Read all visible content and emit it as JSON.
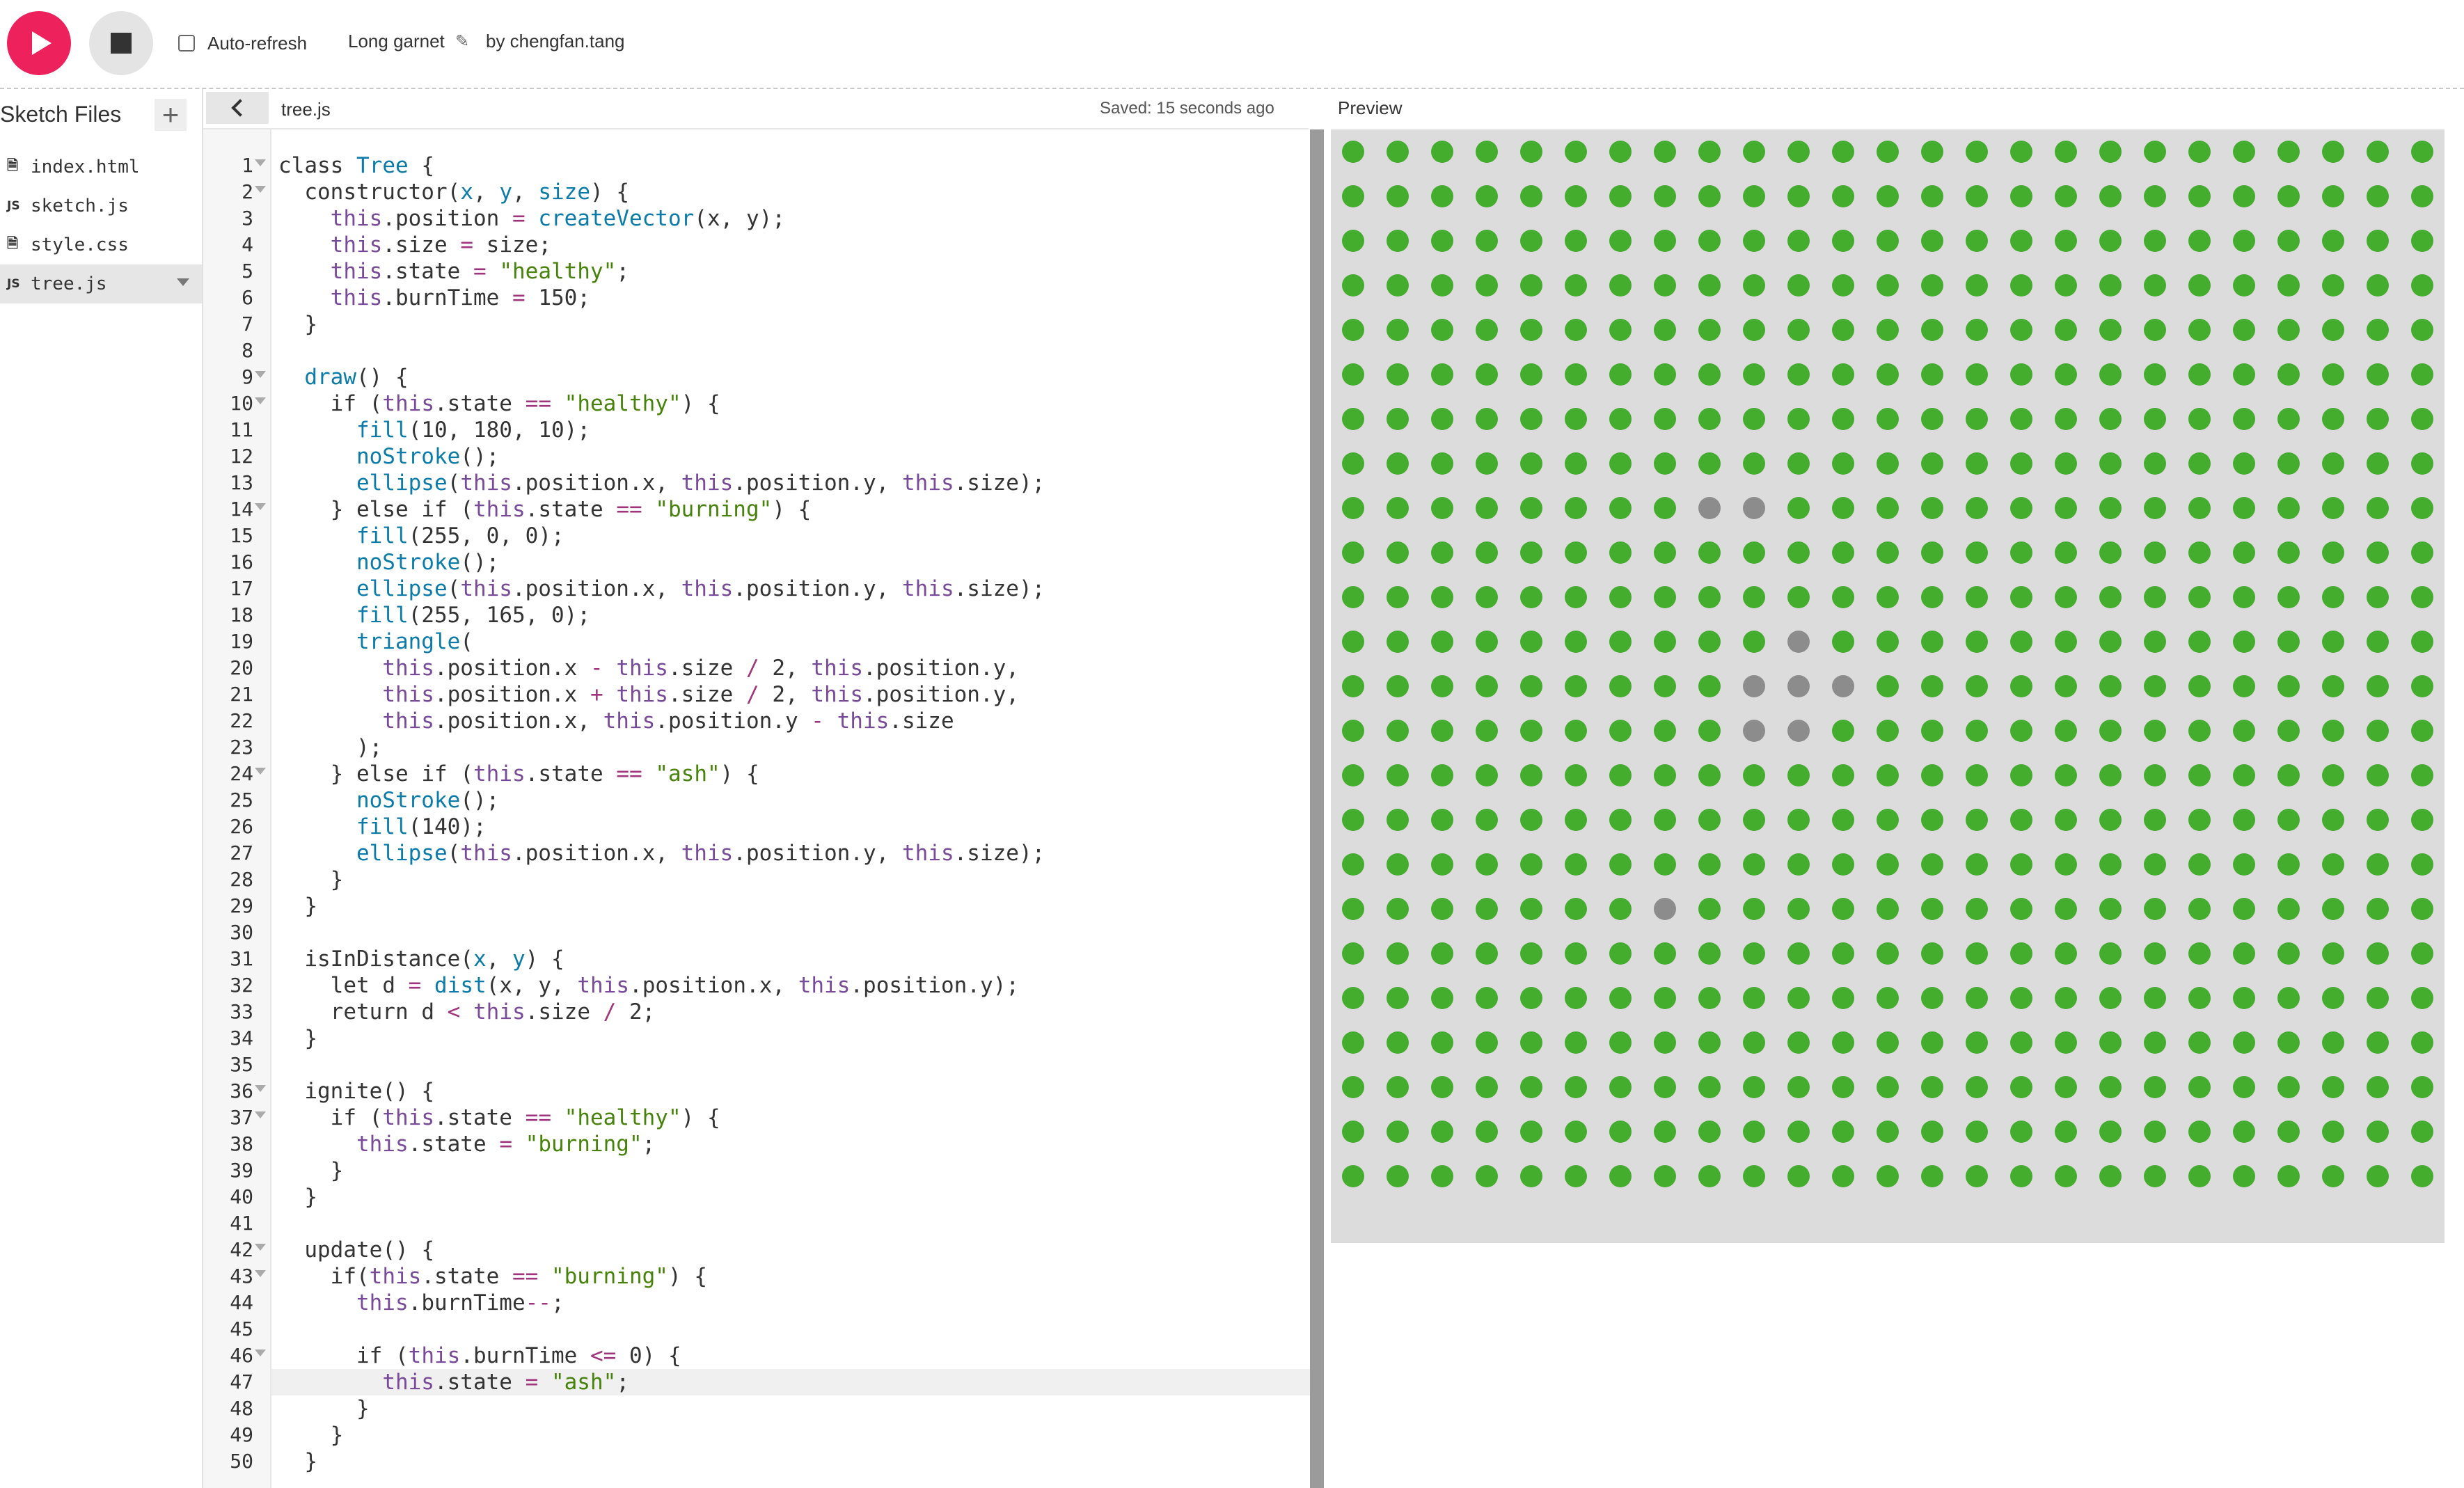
{
  "toolbar": {
    "auto_refresh_label": "Auto-refresh",
    "sketch_name": "Long garnet",
    "sketch_owner": "by chengfan.tang"
  },
  "sidebar": {
    "title": "Sketch Files",
    "files": [
      {
        "icon": "file-icon",
        "type_badge": "",
        "name": "index.html",
        "selected": false
      },
      {
        "icon": "js-file-icon",
        "type_badge": "JS",
        "name": "sketch.js",
        "selected": false
      },
      {
        "icon": "file-icon",
        "type_badge": "",
        "name": "style.css",
        "selected": false
      },
      {
        "icon": "js-file-icon",
        "type_badge": "JS",
        "name": "tree.js",
        "selected": true
      }
    ]
  },
  "editor": {
    "filename": "tree.js",
    "saved_status": "Saved: 15 seconds ago",
    "highlighted_line": 47,
    "fold_lines": [
      1,
      2,
      9,
      10,
      14,
      24,
      36,
      37,
      42,
      43,
      46
    ],
    "lines": [
      "class Tree {",
      "  constructor(x, y, size) {",
      "    this.position = createVector(x, y);",
      "    this.size = size;",
      "    this.state = \"healthy\";",
      "    this.burnTime = 150;",
      "  }",
      "",
      "  draw() {",
      "    if (this.state == \"healthy\") {",
      "      fill(10, 180, 10);",
      "      noStroke();",
      "      ellipse(this.position.x, this.position.y, this.size);",
      "    } else if (this.state == \"burning\") {",
      "      fill(255, 0, 0);",
      "      noStroke();",
      "      ellipse(this.position.x, this.position.y, this.size);",
      "      fill(255, 165, 0);",
      "      triangle(",
      "        this.position.x - this.size / 2, this.position.y,",
      "        this.position.x + this.size / 2, this.position.y,",
      "        this.position.x, this.position.y - this.size",
      "      );",
      "    } else if (this.state == \"ash\") {",
      "      noStroke();",
      "      fill(140);",
      "      ellipse(this.position.x, this.position.y, this.size);",
      "    }",
      "  }",
      "",
      "  isInDistance(x, y) {",
      "    let d = dist(x, y, this.position.x, this.position.y);",
      "    return d < this.size / 2;",
      "  }",
      "",
      "  ignite() {",
      "    if (this.state == \"healthy\") {",
      "      this.state = \"burning\";",
      "    }",
      "  }",
      "",
      "  update() {",
      "    if(this.state == \"burning\") {",
      "      this.burnTime--;",
      "",
      "      if (this.burnTime <= 0) {",
      "        this.state = \"ash\";",
      "      }",
      "    }",
      "  }"
    ]
  },
  "preview": {
    "label": "Preview",
    "grid": {
      "cols": 25,
      "rows": 24,
      "healthy_color": "#45ad2d",
      "ash_color": "#8c8c8c",
      "background_color": "#dcdcdc",
      "ash_cells": [
        [
          8,
          8
        ],
        [
          8,
          9
        ],
        [
          11,
          10
        ],
        [
          12,
          9
        ],
        [
          12,
          10
        ],
        [
          12,
          11
        ],
        [
          13,
          9
        ],
        [
          13,
          10
        ],
        [
          17,
          7
        ]
      ]
    }
  },
  "colors": {
    "play_button": "#ed225d",
    "stop_button": "#e4e4e4"
  }
}
